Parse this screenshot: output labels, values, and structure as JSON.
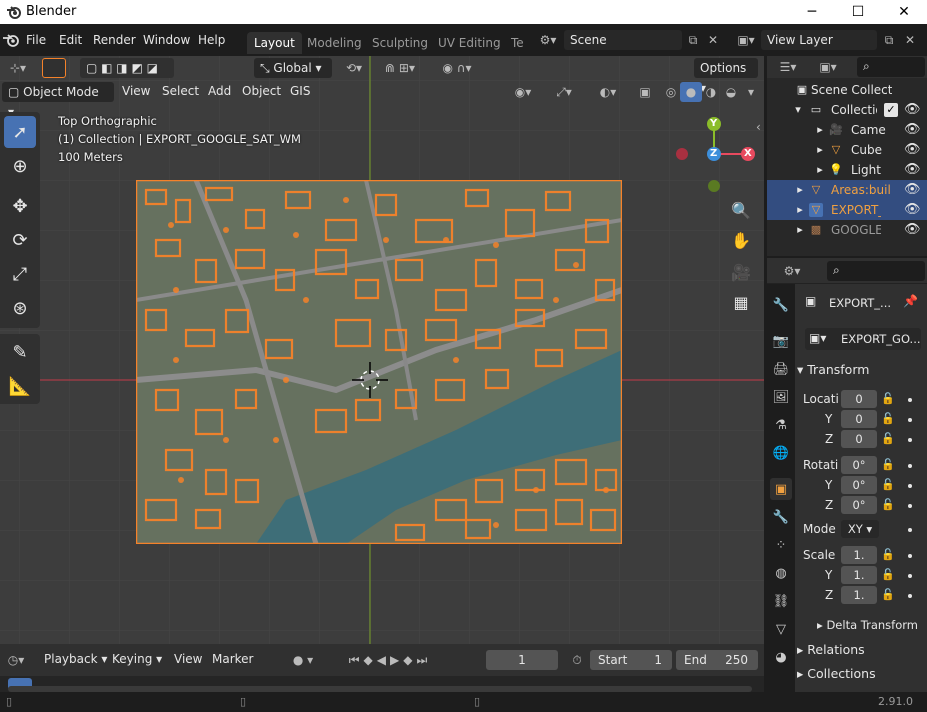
{
  "window": {
    "title": "Blender"
  },
  "menu": [
    "File",
    "Edit",
    "Render",
    "Window",
    "Help"
  ],
  "workspaces": [
    "Layout",
    "Modeling",
    "Sculpting",
    "UV Editing",
    "Te"
  ],
  "scene": {
    "name": "Scene"
  },
  "view_layer": {
    "name": "View Layer"
  },
  "toolbar_top": {
    "orientation": "Global",
    "options": "Options"
  },
  "viewport_header": {
    "mode": "Object Mode",
    "menus": [
      "View",
      "Select",
      "Add",
      "Object",
      "GIS"
    ]
  },
  "viewport_info": {
    "view": "Top Orthographic",
    "collection": "(1) Collection | EXPORT_GOOGLE_SAT_WM",
    "scale": "100 Meters"
  },
  "gizmo": {
    "y": "Y",
    "z": "Z",
    "x": "X"
  },
  "outliner": {
    "root": "Scene Collect",
    "items": [
      {
        "label": "Collection",
        "depth": 1,
        "selected": false
      },
      {
        "label": "Came",
        "depth": 2,
        "selected": false
      },
      {
        "label": "Cube",
        "depth": 2,
        "selected": false
      },
      {
        "label": "Light",
        "depth": 2,
        "selected": false
      },
      {
        "label": "Areas:buil",
        "depth": 1,
        "selected": true
      },
      {
        "label": "EXPORT_G",
        "depth": 1,
        "selected": true
      },
      {
        "label": "GOOGLE_",
        "depth": 1,
        "selected": false
      }
    ]
  },
  "properties": {
    "object_name": "EXPORT_...",
    "data_name": "EXPORT_GO...",
    "transform": {
      "title": "Transform",
      "location_label": "Locati",
      "location": [
        "0",
        "0",
        "0"
      ],
      "rotation_label": "Rotati",
      "rotation": [
        "0°",
        "0°",
        "0°"
      ],
      "mode_label": "Mode",
      "mode": "XY",
      "scale_label": "Scale",
      "scale": [
        "1.",
        "1.",
        "1."
      ],
      "axis_y": "Y",
      "axis_z": "Z"
    },
    "delta_transform": "Delta Transform",
    "relations": "Relations",
    "collections": "Collections"
  },
  "timeline": {
    "menus": [
      "Playback",
      "Keying",
      "View",
      "Marker"
    ],
    "current_frame": "1",
    "start_label": "Start",
    "start": "1",
    "end_label": "End",
    "end": "250"
  },
  "status": {
    "version": "2.91.0"
  },
  "colors": {
    "accent_blue": "#4772b3",
    "selection_orange": "#f5822a",
    "x_axis": "#e84a5f",
    "y_axis": "#8bbd2a",
    "z_axis": "#3d8fdb"
  }
}
